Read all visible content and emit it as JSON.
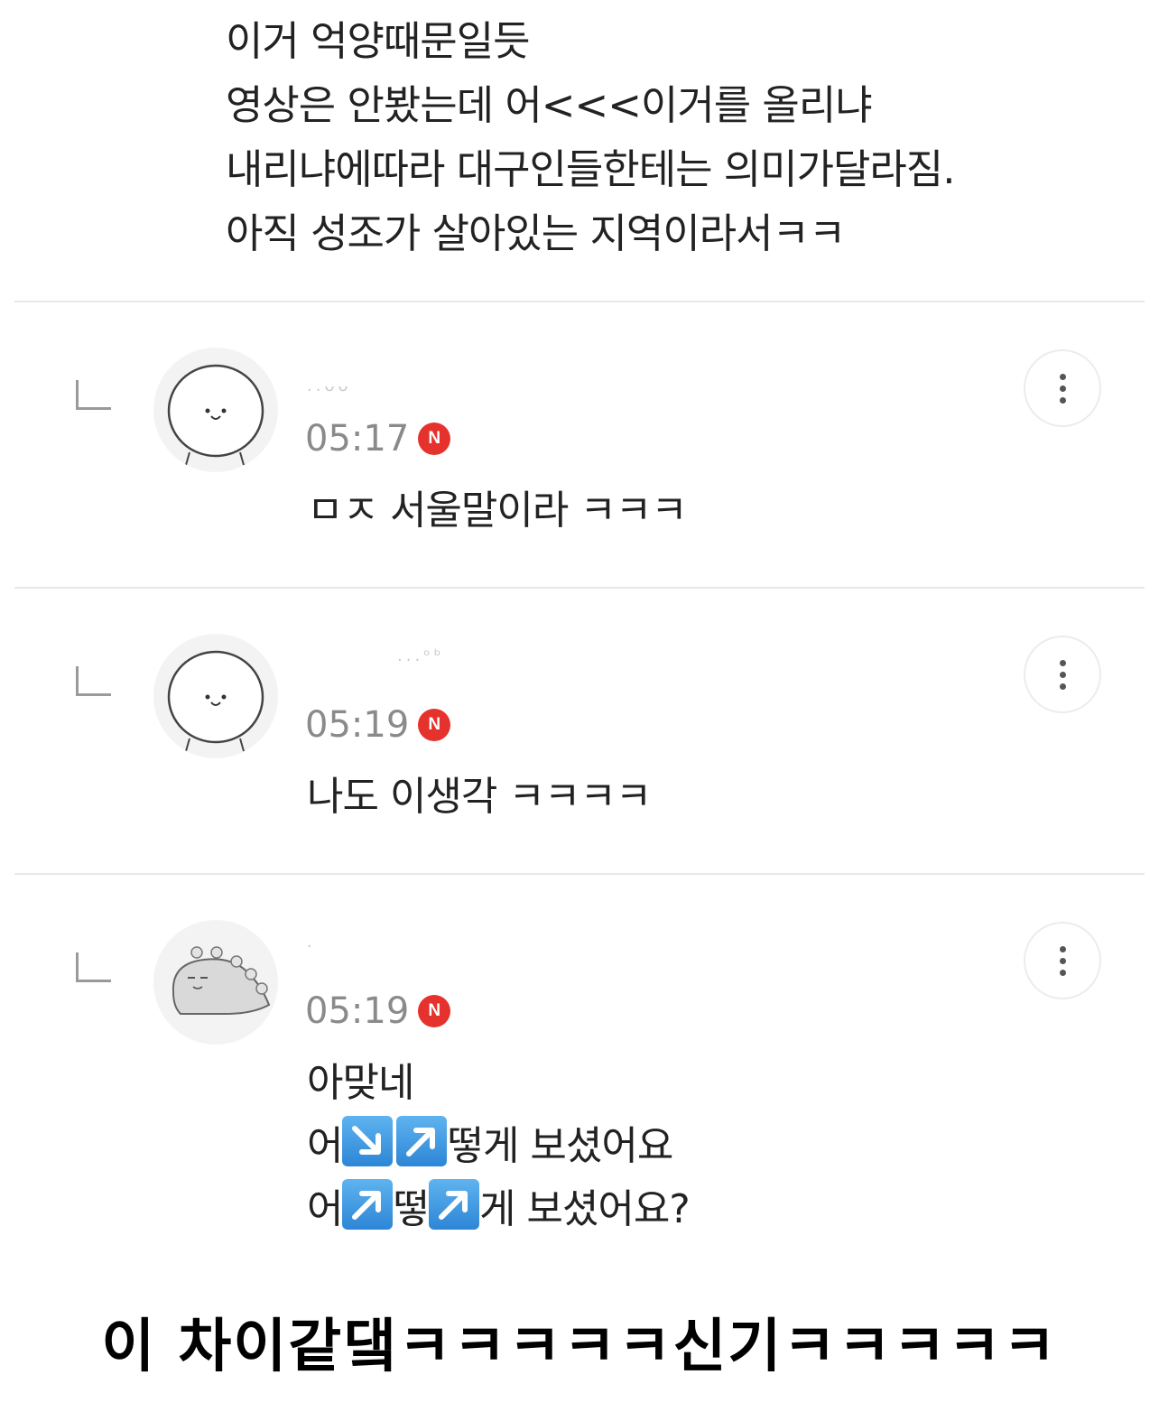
{
  "post": {
    "lines": [
      "이거 억양때문일듯",
      "영상은 안봤는데 어<<<이거를 올리냐",
      "내리냐에따라 대구인들한테는 의미가달라짐.",
      "아직 성조가 살아있는 지역이라서ㅋㅋ"
    ]
  },
  "comments": [
    {
      "username": "..ᴗᴗ",
      "time": "05:17",
      "badge": "N",
      "avatar_icon": "cat-face-icon",
      "text_lines": [
        "ㅁㅈ 서울말이라 ㅋㅋㅋ"
      ]
    },
    {
      "username": "...ᵒᵇ",
      "time": "05:19",
      "badge": "N",
      "avatar_icon": "cat-face-icon",
      "text_lines": [
        "나도 이생각 ㅋㅋㅋㅋ"
      ]
    },
    {
      "username": ".",
      "time": "05:19",
      "badge": "N",
      "avatar_icon": "dinosaur-icon",
      "text_lines": [
        "아맞네",
        "어↘️↗️떻게 보셨어요",
        "어↗️떻↗️게 보셨어요?"
      ],
      "text_parts": {
        "line2_a": "어",
        "line2_b": "떻게 보셨어요",
        "line3_a": "어",
        "line3_b": "떻",
        "line3_c": "게 보셨어요?"
      }
    }
  ],
  "caption": "이 차이같댘ㅋㅋㅋㅋㅋ신기ㅋㅋㅋㅋㅋ",
  "colors": {
    "badge": "#e5322d",
    "arrow_emoji": "#3a92de",
    "divider": "#e8e8e8"
  }
}
